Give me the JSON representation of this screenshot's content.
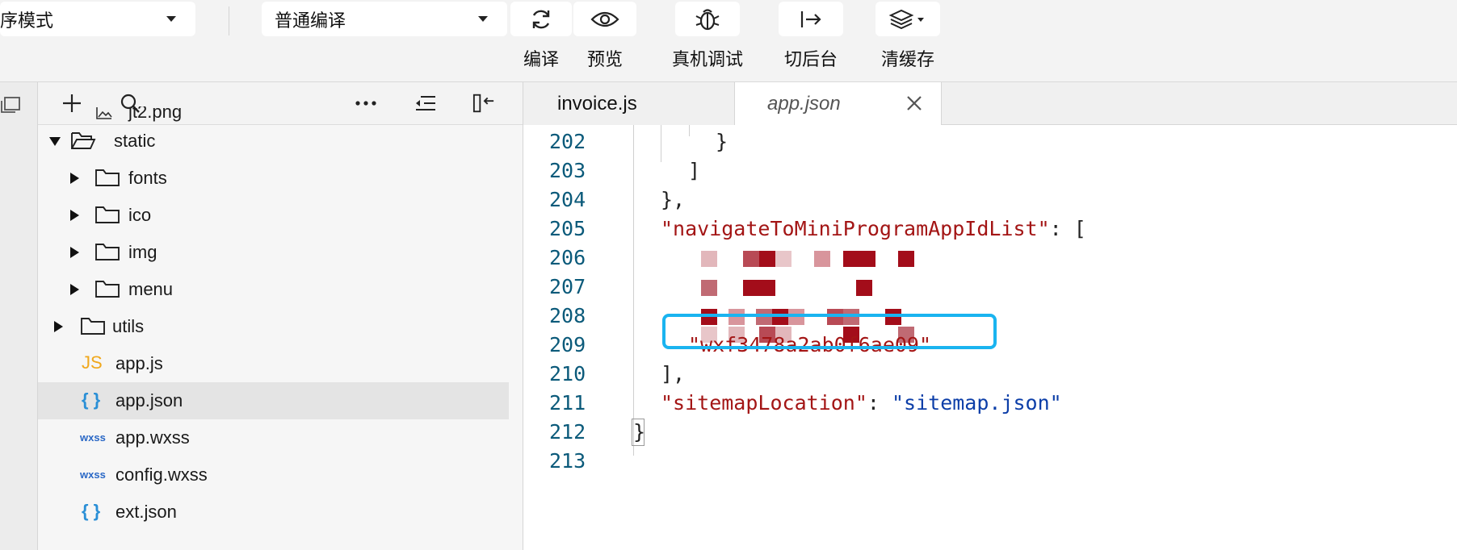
{
  "toolbar": {
    "mode_select": "序模式",
    "compile_select": "普通编译",
    "buttons": [
      {
        "label": "编译",
        "icon": "refresh-icon"
      },
      {
        "label": "预览",
        "icon": "eye-icon"
      },
      {
        "label": "真机调试",
        "icon": "bug-icon"
      },
      {
        "label": "切后台",
        "icon": "switch-background-icon"
      },
      {
        "label": "清缓存",
        "icon": "layers-icon"
      }
    ]
  },
  "sidebar": {
    "tree": [
      {
        "name": "jt2.png",
        "type": "image"
      },
      {
        "name": "static",
        "type": "folder-open"
      },
      {
        "name": "fonts",
        "type": "folder"
      },
      {
        "name": "ico",
        "type": "folder"
      },
      {
        "name": "img",
        "type": "folder"
      },
      {
        "name": "menu",
        "type": "folder"
      },
      {
        "name": "utils",
        "type": "folder"
      },
      {
        "name": "app.js",
        "type": "js",
        "badge": "JS"
      },
      {
        "name": "app.json",
        "type": "json",
        "badge": "{ }",
        "selected": true
      },
      {
        "name": "app.wxss",
        "type": "wxss",
        "badge": "wxss"
      },
      {
        "name": "config.wxss",
        "type": "wxss",
        "badge": "wxss"
      },
      {
        "name": "ext.json",
        "type": "json",
        "badge": "{ }"
      }
    ]
  },
  "tabs": [
    {
      "label": "invoice.js",
      "active": false
    },
    {
      "label": "app.json",
      "active": true
    }
  ],
  "editor": {
    "line_numbers": [
      "202",
      "203",
      "204",
      "205",
      "206",
      "207",
      "208",
      "209",
      "210",
      "211",
      "212",
      "213"
    ],
    "lines": {
      "l202": "}",
      "l203": "]",
      "l204": "},",
      "l205_key": "\"navigateToMiniProgramAppIdList\"",
      "l205_rest": ": [",
      "l210": "\"wxf3478a2ab0f6ae09\"",
      "l211": "],",
      "l212_key": "\"sitemapLocation\"",
      "l212_colon": ": ",
      "l212_val": "\"sitemap.json\"",
      "l213": "}"
    }
  },
  "colors": {
    "string_key": "#a31515",
    "string_value": "#0c3ea8",
    "line_number": "#0b5a7a",
    "highlight_box": "#1ab4f0",
    "redaction": "#a30d1a"
  }
}
